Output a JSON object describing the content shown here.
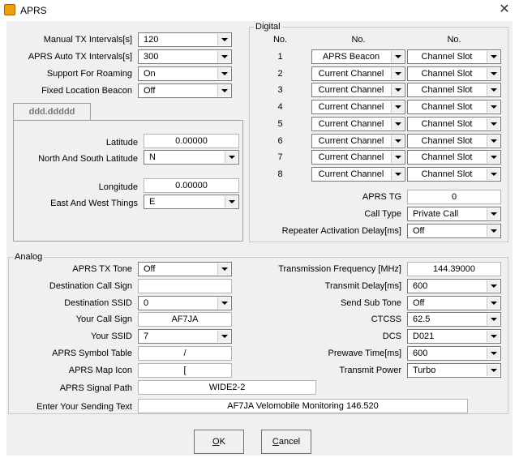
{
  "window": {
    "title": "APRS",
    "close_glyph": "✕",
    "app_icon": "aprs-app-icon"
  },
  "top_left": {
    "fields": [
      {
        "label": "Manual TX Intervals[s]",
        "value": "120"
      },
      {
        "label": "APRS Auto TX Intervals[s]",
        "value": "300"
      },
      {
        "label": "Support For Roaming",
        "value": "On"
      },
      {
        "label": "Fixed Location Beacon",
        "value": "Off"
      }
    ],
    "tab_label": "ddd.ddddd",
    "latitude_label": "Latitude",
    "latitude_value": "0.00000",
    "ns_label": "North And South Latitude",
    "ns_value": "N",
    "longitude_label": "Longitude",
    "longitude_value": "0.00000",
    "ew_label": "East  And West Things",
    "ew_value": "E"
  },
  "digital": {
    "group_label": "Digital",
    "headers": [
      "No.",
      "No.",
      "No."
    ],
    "rows": [
      {
        "no": "1",
        "ch": "APRS Beacon",
        "slot": "Channel Slot"
      },
      {
        "no": "2",
        "ch": "Current Channel",
        "slot": "Channel Slot"
      },
      {
        "no": "3",
        "ch": "Current Channel",
        "slot": "Channel Slot"
      },
      {
        "no": "4",
        "ch": "Current Channel",
        "slot": "Channel Slot"
      },
      {
        "no": "5",
        "ch": "Current Channel",
        "slot": "Channel Slot"
      },
      {
        "no": "6",
        "ch": "Current Channel",
        "slot": "Channel Slot"
      },
      {
        "no": "7",
        "ch": "Current Channel",
        "slot": "Channel Slot"
      },
      {
        "no": "8",
        "ch": "Current Channel",
        "slot": "Channel Slot"
      }
    ],
    "aprs_tg_label": "APRS TG",
    "aprs_tg_value": "0",
    "call_type_label": "Call Type",
    "call_type_value": "Private Call",
    "repeater_label": "Repeater Activation Delay[ms]",
    "repeater_value": "Off"
  },
  "analog": {
    "group_label": "Analog",
    "left": [
      {
        "label": "APRS TX Tone",
        "value": "Off",
        "kind": "combo"
      },
      {
        "label": "Destination Call Sign",
        "value": "",
        "kind": "edit"
      },
      {
        "label": "Destination SSID",
        "value": "0",
        "kind": "combo"
      },
      {
        "label": "Your Call Sign",
        "value": "AF7JA",
        "kind": "edit"
      },
      {
        "label": "Your SSID",
        "value": "7",
        "kind": "combo"
      },
      {
        "label": "APRS Symbol Table",
        "value": "/",
        "kind": "edit"
      },
      {
        "label": "APRS Map Icon",
        "value": "[",
        "kind": "edit"
      }
    ],
    "right": [
      {
        "label": "Transmission Frequency [MHz]",
        "value": "144.39000",
        "kind": "edit"
      },
      {
        "label": "Transmit Delay[ms]",
        "value": "600",
        "kind": "combo"
      },
      {
        "label": "Send Sub Tone",
        "value": "Off",
        "kind": "combo"
      },
      {
        "label": "CTCSS",
        "value": "62.5",
        "kind": "combo"
      },
      {
        "label": "DCS",
        "value": "D021",
        "kind": "combo"
      },
      {
        "label": "Prewave Time[ms]",
        "value": "600",
        "kind": "combo"
      },
      {
        "label": "Transmit Power",
        "value": "Turbo",
        "kind": "combo"
      }
    ],
    "signal_path_label": "APRS Signal Path",
    "signal_path_value": "WIDE2-2",
    "sending_text_label": "Enter Your Sending Text",
    "sending_text_value": "AF7JA Velomobile Monitoring 146.520"
  },
  "buttons": {
    "ok_accel": "O",
    "ok_rest": "K",
    "cancel_accel": "C",
    "cancel_rest": "ancel"
  }
}
